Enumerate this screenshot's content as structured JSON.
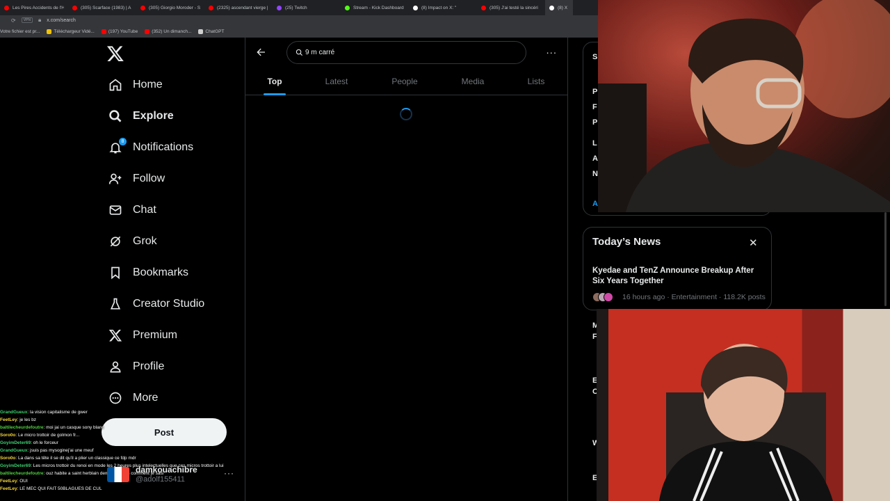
{
  "browser": {
    "tabs": [
      {
        "title": "Les Pires Accidents de l'H",
        "color": "#ff0000"
      },
      {
        "title": "(305) Scarface (1983) | A",
        "color": "#ff0000"
      },
      {
        "title": "(305) Giorgio Moroder - S",
        "color": "#ff0000"
      },
      {
        "title": "(2325) ascendant vierge |",
        "color": "#ff0000"
      },
      {
        "title": "(25) Twitch",
        "color": "#9146ff"
      },
      {
        "title": "Stream - Kick Dashboard",
        "color": "#53fc18"
      },
      {
        "title": "(8) Impact on X: \"",
        "color": "#ffffff"
      },
      {
        "title": "(305) J'ai testé la sincéri",
        "color": "#ff0000"
      },
      {
        "title": "(8) X",
        "color": "#ffffff"
      }
    ],
    "url": "x.com/search",
    "vpn": "VPN",
    "bookmarks": [
      {
        "label": "Votre fichier est pr...",
        "color": "#3a3a3a"
      },
      {
        "label": "Téléchargeur Vidé...",
        "color": "#f2c400"
      },
      {
        "label": "(197) YouTube",
        "color": "#ff0000"
      },
      {
        "label": "(352) Un dimanch...",
        "color": "#ff0000"
      },
      {
        "label": "ChatGPT",
        "color": "#cfcfcf"
      }
    ]
  },
  "nav": {
    "items": [
      {
        "label": "Home",
        "icon": "home-icon"
      },
      {
        "label": "Explore",
        "icon": "search-icon"
      },
      {
        "label": "Notifications",
        "icon": "bell-icon"
      },
      {
        "label": "Follow",
        "icon": "follow-icon"
      },
      {
        "label": "Chat",
        "icon": "mail-icon"
      },
      {
        "label": "Grok",
        "icon": "grok-icon"
      },
      {
        "label": "Bookmarks",
        "icon": "bookmark-icon"
      },
      {
        "label": "Creator Studio",
        "icon": "creator-icon"
      },
      {
        "label": "Premium",
        "icon": "x-logo-icon"
      },
      {
        "label": "Profile",
        "icon": "person-icon"
      },
      {
        "label": "More",
        "icon": "more-icon"
      }
    ],
    "notif_count": "8",
    "post_label": "Post"
  },
  "user": {
    "name": "damkouachibre",
    "handle": "@adolf155411"
  },
  "search": {
    "query": "9 m carré",
    "tabs": [
      "Top",
      "Latest",
      "People",
      "Media",
      "Lists"
    ],
    "active_tab": "Top"
  },
  "news": {
    "title": "Today’s News",
    "headline": "Kyedae and TenZ Announce Breakup After Six Years Together",
    "meta": "16 hours ago · Entertainment · 118.2K posts"
  },
  "right_fragments": [
    "S",
    "P",
    "F",
    "P",
    "L",
    "A",
    "N",
    "A",
    "M",
    "F",
    "E",
    "C",
    "W",
    "E"
  ],
  "chat": [
    {
      "user": "GrandGueux",
      "color": "#3bd16f",
      "msg": "la vision capitalisme de gwer"
    },
    {
      "user": "FeetLey",
      "color": "#f7d83a",
      "msg": "je les bz"
    },
    {
      "user": "baltilecheurdefoutre",
      "color": "#4fd13f",
      "msg": "moi jai un casque sony blanc"
    },
    {
      "user": "Soro0o",
      "color": "#f7d83a",
      "msg": "Le micro trottoir de golmon fr..."
    },
    {
      "user": "GoyimDeter69",
      "color": "#3bd16f",
      "msg": "oh le forceur"
    },
    {
      "user": "GrandGueux",
      "color": "#3bd16f",
      "msg": "jsuis pas mysoginej'ai une meuf"
    },
    {
      "user": "Soro0o",
      "color": "#f7d83a",
      "msg": "La dans sa tête il se dit qu'il a plier un classique ce fdp mdr"
    },
    {
      "user": "GoyimDeter69",
      "color": "#3bd16f",
      "msg": "Les micros trottoir du renoi en mode les 2 heures plus intelectuelles que ces micros trottoir a lui"
    },
    {
      "user": "baltilecheurdefoutre",
      "color": "#4fd13f",
      "msg": "ouz habite a saint herblain demandez pas comment je sais"
    },
    {
      "user": "FeetLey",
      "color": "#f7d83a",
      "msg": "OUI"
    },
    {
      "user": "FeetLey",
      "color": "#f7d83a",
      "msg": "LE MEC QUI FAIT 50BLAGUES DE CUL"
    }
  ]
}
